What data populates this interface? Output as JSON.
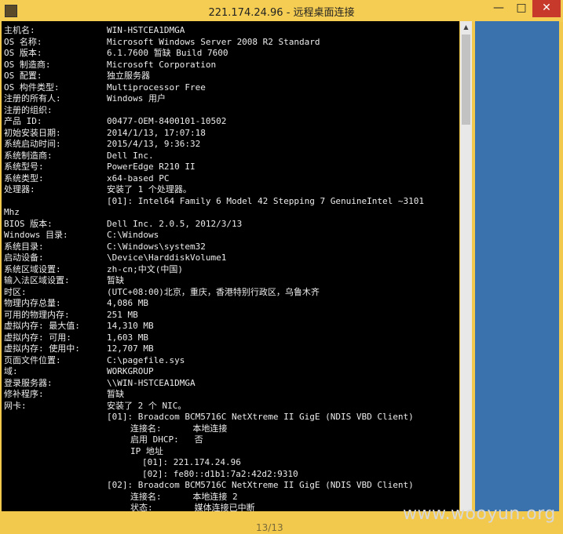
{
  "window": {
    "title": "221.174.24.96 - 远程桌面连接"
  },
  "controls": {
    "minimize": "—",
    "maximize": "□",
    "close": "✕"
  },
  "console": {
    "lines": [
      {
        "k": "主机名:",
        "v": "WIN-HSTCEA1DMGA"
      },
      {
        "k": "OS 名称:",
        "v": "Microsoft Windows Server 2008 R2 Standard"
      },
      {
        "k": "OS 版本:",
        "v": "6.1.7600 暂缺 Build 7600"
      },
      {
        "k": "OS 制造商:",
        "v": "Microsoft Corporation"
      },
      {
        "k": "OS 配置:",
        "v": "独立服务器"
      },
      {
        "k": "OS 构件类型:",
        "v": "Multiprocessor Free"
      },
      {
        "k": "注册的所有人:",
        "v": "Windows 用户"
      },
      {
        "k": "注册的组织:",
        "v": ""
      },
      {
        "k": "产品 ID:",
        "v": "00477-OEM-8400101-10502"
      },
      {
        "k": "初始安装日期:",
        "v": "2014/1/13, 17:07:18"
      },
      {
        "k": "系统启动时间:",
        "v": "2015/4/13, 9:36:32"
      },
      {
        "k": "系统制造商:",
        "v": "Dell Inc."
      },
      {
        "k": "系统型号:",
        "v": "PowerEdge R210 II"
      },
      {
        "k": "系统类型:",
        "v": "x64-based PC"
      },
      {
        "k": "处理器:",
        "v": "安装了 1 个处理器。"
      },
      {
        "k": "",
        "v": "[01]: Intel64 Family 6 Model 42 Stepping 7 GenuineIntel ~3101"
      },
      {
        "k": "Mhz",
        "v": ""
      },
      {
        "k": "BIOS 版本:",
        "v": "Dell Inc. 2.0.5, 2012/3/13"
      },
      {
        "k": "Windows 目录:",
        "v": "C:\\Windows"
      },
      {
        "k": "系统目录:",
        "v": "C:\\Windows\\system32"
      },
      {
        "k": "启动设备:",
        "v": "\\Device\\HarddiskVolume1"
      },
      {
        "k": "系统区域设置:",
        "v": "zh-cn;中文(中国)"
      },
      {
        "k": "输入法区域设置:",
        "v": "暂缺"
      },
      {
        "k": "时区:",
        "v": "(UTC+08:00)北京，重庆，香港特别行政区，乌鲁木齐"
      },
      {
        "k": "物理内存总量:",
        "v": "4,086 MB"
      },
      {
        "k": "可用的物理内存:",
        "v": "251 MB"
      },
      {
        "k": "虚拟内存: 最大值:",
        "v": "14,310 MB"
      },
      {
        "k": "虚拟内存: 可用:",
        "v": "1,603 MB"
      },
      {
        "k": "虚拟内存: 使用中:",
        "v": "12,707 MB"
      },
      {
        "k": "页面文件位置:",
        "v": "C:\\pagefile.sys"
      },
      {
        "k": "域:",
        "v": "WORKGROUP"
      },
      {
        "k": "登录服务器:",
        "v": "\\\\WIN-HSTCEA1DMGA"
      },
      {
        "k": "修补程序:",
        "v": "暂缺"
      },
      {
        "k": "网卡:",
        "v": "安装了 2 个 NIC。"
      },
      {
        "k": "",
        "v": "[01]: Broadcom BCM5716C NetXtreme II GigE (NDIS VBD Client)"
      },
      {
        "k": "",
        "v": "连接名:      本地连接"
      },
      {
        "k": "",
        "v": "启用 DHCP:   否"
      },
      {
        "k": "",
        "v": "IP 地址"
      },
      {
        "k": "",
        "v": "[01]: 221.174.24.96"
      },
      {
        "k": "",
        "v": "[02]: fe80::d1b1:7a2:42d2:9310"
      },
      {
        "k": "",
        "v": "[02]: Broadcom BCM5716C NetXtreme II GigE (NDIS VBD Client)"
      },
      {
        "k": "",
        "v": "连接名:      本地连接 2"
      },
      {
        "k": "",
        "v": "状态:        媒体连接已中断"
      }
    ]
  },
  "status": {
    "page": "13/13"
  },
  "watermark": "www.wooyun.org",
  "colors": {
    "title_bg": "#f4cd52",
    "console_bg": "#000000",
    "console_fg": "#ececec",
    "panel_blue": "#3a72ae",
    "close_red": "#c7392b"
  }
}
